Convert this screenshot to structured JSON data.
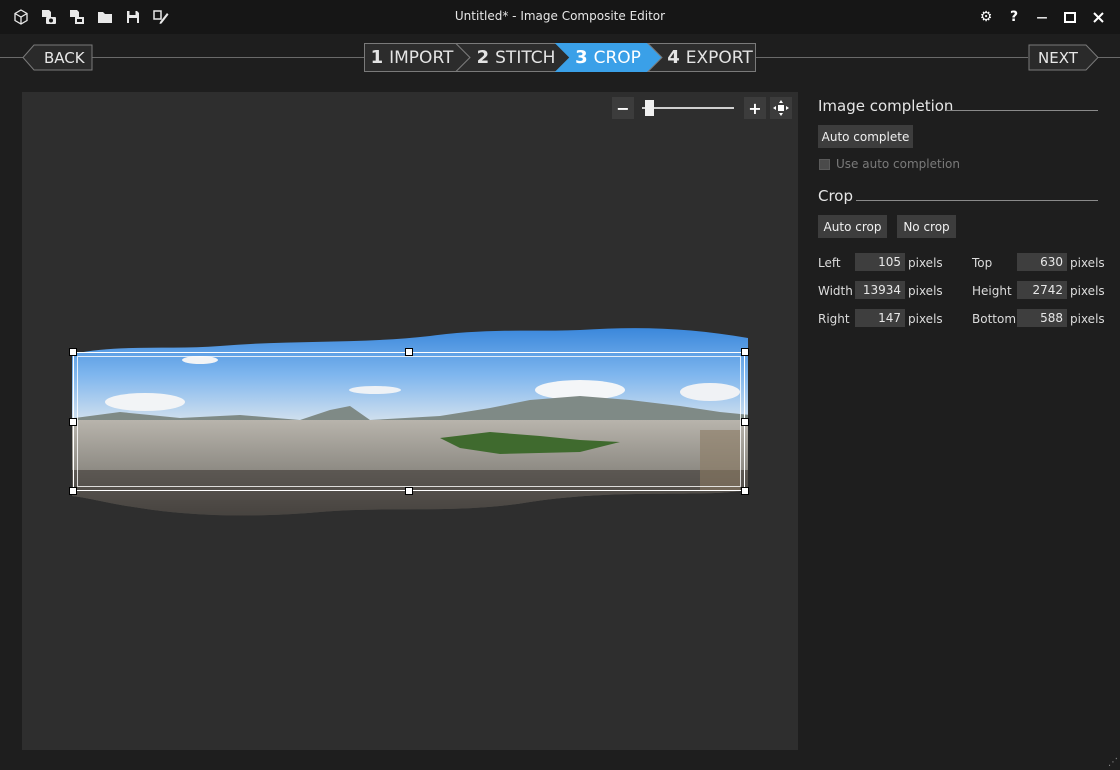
{
  "window": {
    "title": "Untitled* - Image Composite Editor",
    "toolbar_icons": [
      "new-panorama-icon",
      "new-from-video-icon",
      "new-from-images-icon",
      "open-icon",
      "save-icon",
      "save-as-icon"
    ],
    "controls": {
      "settings": "⚙",
      "help": "?",
      "minimize": "—",
      "maximize": "□",
      "close": "✕"
    }
  },
  "nav": {
    "back_label": "BACK",
    "next_label": "NEXT",
    "steps": [
      {
        "num": "1",
        "label": "IMPORT"
      },
      {
        "num": "2",
        "label": "STITCH"
      },
      {
        "num": "3",
        "label": "CROP"
      },
      {
        "num": "4",
        "label": "EXPORT"
      }
    ],
    "active_step": 3,
    "active_color": "#3aa0e8"
  },
  "zoom": {
    "minus": "−",
    "plus": "+",
    "level": 0.05
  },
  "panel": {
    "completion": {
      "title": "Image completion",
      "auto_complete_label": "Auto complete",
      "use_auto_label": "Use auto completion",
      "use_auto_checked": false
    },
    "crop": {
      "title": "Crop",
      "auto_crop_label": "Auto crop",
      "no_crop_label": "No crop",
      "unit": "pixels",
      "fields": {
        "left": {
          "label": "Left",
          "value": "105"
        },
        "top": {
          "label": "Top",
          "value": "630"
        },
        "width": {
          "label": "Width",
          "value": "13934"
        },
        "height": {
          "label": "Height",
          "value": "2742"
        },
        "right": {
          "label": "Right",
          "value": "147"
        },
        "bottom": {
          "label": "Bottom",
          "value": "588"
        }
      }
    }
  }
}
